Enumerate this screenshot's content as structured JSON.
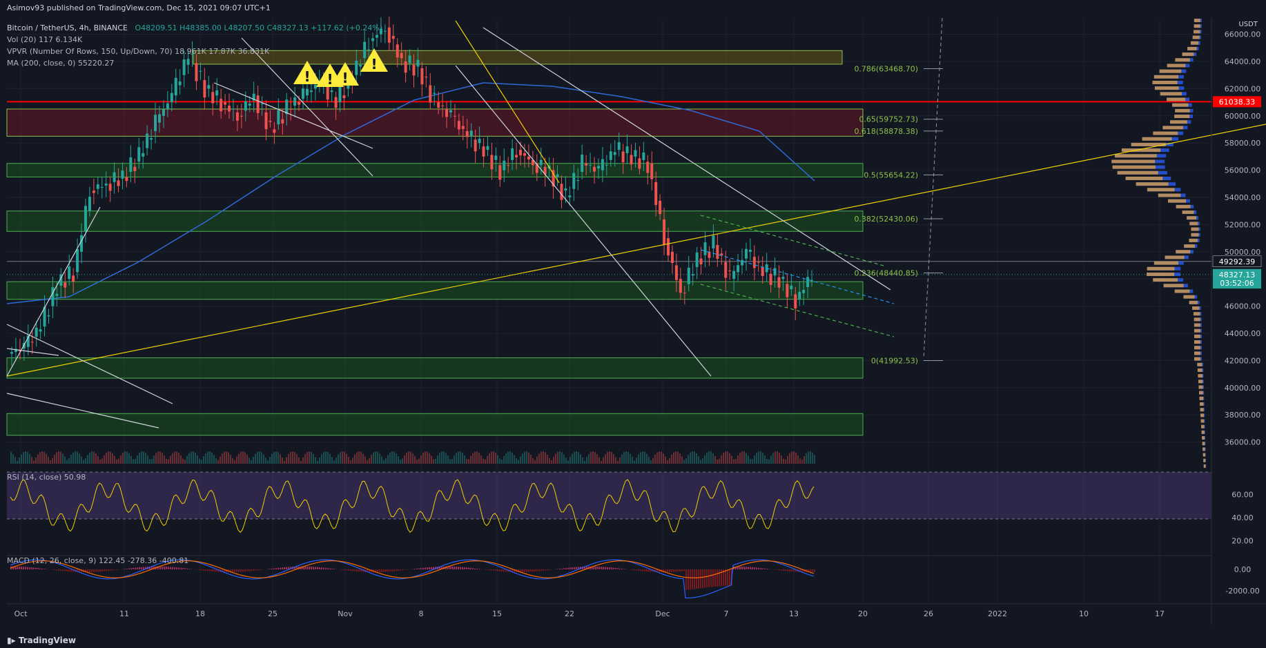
{
  "header": {
    "published": "Asimov93 published on TradingView.com, Dec 15, 2021 09:07 UTC+1",
    "symbol": "Bitcoin / TetherUS, 4h, BINANCE",
    "ohlc": "O48209.51  H48385.00  L48207.50  C48327.13  +117.62 (+0.24%)",
    "vol": "Vol (20)  117  6.134K",
    "vpvr": "VPVR (Number Of Rows, 150, Up/Down, 70)  18.961K  17.87K  36.831K",
    "ma": "MA (200, close, 0)  55220.27",
    "rsi": "RSI (14, close)  50.98",
    "macd": "MACD (12, 26, close, 9)  122.45  -278.36  -400.81"
  },
  "footer": {
    "brand": "TradingView"
  },
  "currency": "USDT",
  "colors": {
    "bg": "#131722",
    "grid": "#1e222d",
    "up": "#26a69a",
    "down": "#ef5350",
    "zone": "#1b5e20",
    "res": "#ff0000",
    "ma": "#2962ff"
  },
  "chart_data": {
    "type": "candlestick",
    "x_ticks": [
      "Oct",
      "11",
      "18",
      "25",
      "Nov",
      "8",
      "15",
      "22",
      "Dec",
      "7",
      "13",
      "20",
      "26",
      "2022",
      "10",
      "17"
    ],
    "y_ticks": [
      36000,
      38000,
      40000,
      42000,
      44000,
      46000,
      48000,
      50000,
      52000,
      54000,
      56000,
      58000,
      60000,
      62000,
      64000,
      66000
    ],
    "ylim": [
      34000,
      67200
    ],
    "price_labels": [
      {
        "text": "61038.33",
        "value": 61038.33,
        "color": "#ff0000"
      },
      {
        "text": "49292.39",
        "value": 49292.39,
        "color": "#131722"
      },
      {
        "text": "48327.13",
        "value": 48327.13,
        "color": "#26a69a"
      },
      {
        "text": "03:52:06",
        "value": 47700,
        "color": "#26a69a"
      }
    ],
    "fib_levels": [
      {
        "text": "0.786(63468.70)",
        "value": 63468.7
      },
      {
        "text": "0.65(59752.73)",
        "value": 59752.73
      },
      {
        "text": "0.618(58878.38)",
        "value": 58878.38
      },
      {
        "text": "0.5(55654.22)",
        "value": 55654.22
      },
      {
        "text": "0.382(52430.06)",
        "value": 52430.06
      },
      {
        "text": "0.236(48440.85)",
        "value": 48440.85
      },
      {
        "text": "0(41992.53)",
        "value": 41992.53
      }
    ],
    "zones": [
      {
        "low": 58500,
        "high": 60500,
        "kind": "resistance"
      },
      {
        "low": 55500,
        "high": 56500,
        "kind": "support"
      },
      {
        "low": 51500,
        "high": 53000,
        "kind": "support"
      },
      {
        "low": 46500,
        "high": 47800,
        "kind": "support"
      },
      {
        "low": 40700,
        "high": 42200,
        "kind": "support"
      },
      {
        "low": 36500,
        "high": 38100,
        "kind": "support"
      }
    ],
    "close_series": [
      43000,
      44500,
      47500,
      48500,
      54500,
      55000,
      55500,
      57000,
      59500,
      61500,
      64500,
      62000,
      61000,
      60000,
      61500,
      59000,
      60500,
      61500,
      62500,
      61000,
      63000,
      65500,
      66500,
      64000,
      63500,
      61000,
      60000,
      58500,
      57500,
      56000,
      57500,
      56500,
      56000,
      54000,
      56500,
      56000,
      57500,
      57000,
      56500,
      51000,
      47000,
      49500,
      50500,
      48000,
      50000,
      48500,
      48000,
      46500,
      48300
    ],
    "rsi_ticks": [
      20,
      40,
      60
    ],
    "macd_ticks": [
      -2000,
      0
    ]
  }
}
